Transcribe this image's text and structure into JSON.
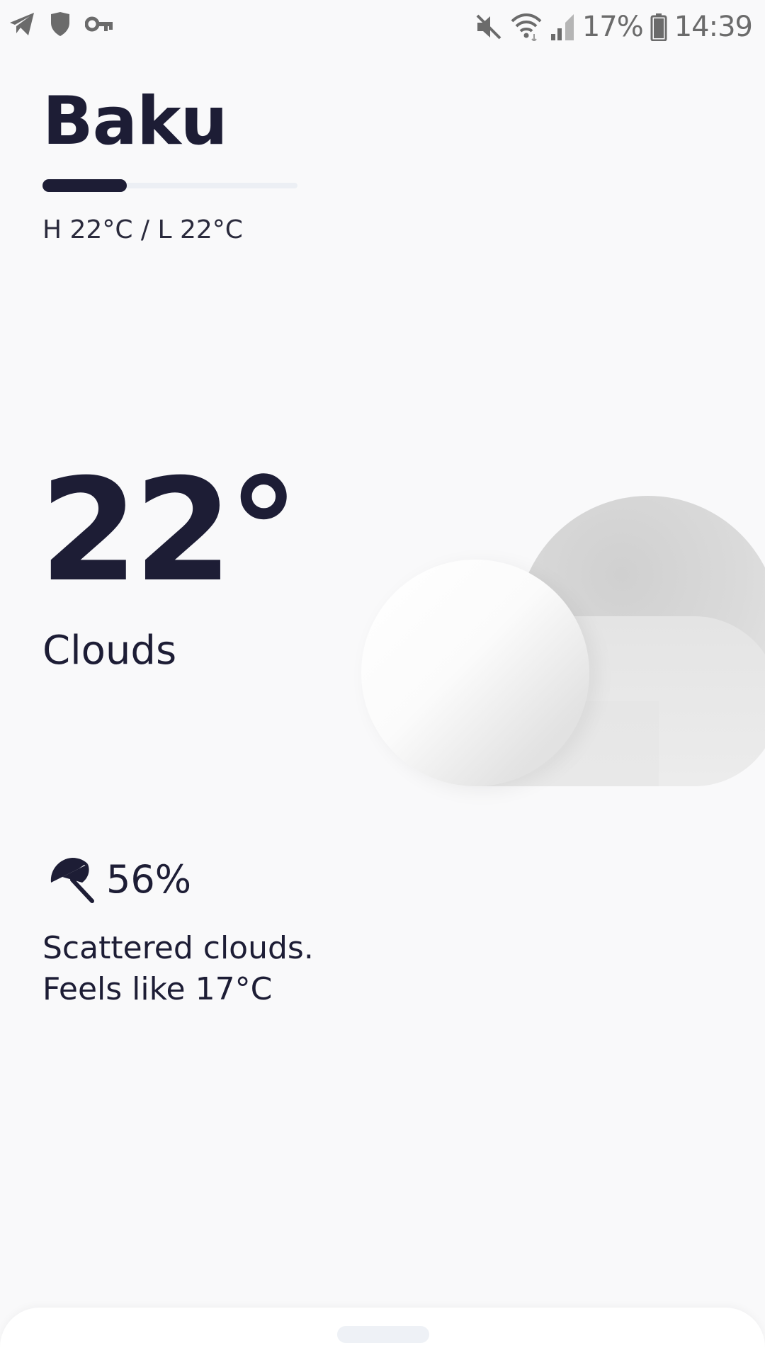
{
  "status_bar": {
    "left_icons": [
      "telegram-icon",
      "shield-icon",
      "key-icon"
    ],
    "right_icons": [
      "mute-icon",
      "wifi-icon",
      "signal-icon",
      "battery-icon"
    ],
    "battery": "17%",
    "time": "14:39"
  },
  "weather": {
    "city": "Baku",
    "day_progress": 0.33,
    "hi_lo": "H 22°C / L 22°C",
    "temperature": "22°",
    "condition": "Clouds",
    "condition_icon": "cloud-illustration",
    "precipitation": "56%",
    "precipitation_icon": "umbrella-icon",
    "description_line1": "Scattered clouds.",
    "description_line2": "Feels like 17°C"
  },
  "colors": {
    "background": "#f9f9fa",
    "text": "#1d1d35",
    "status_text": "#6b6b6b",
    "progress_track": "#eceff4"
  }
}
